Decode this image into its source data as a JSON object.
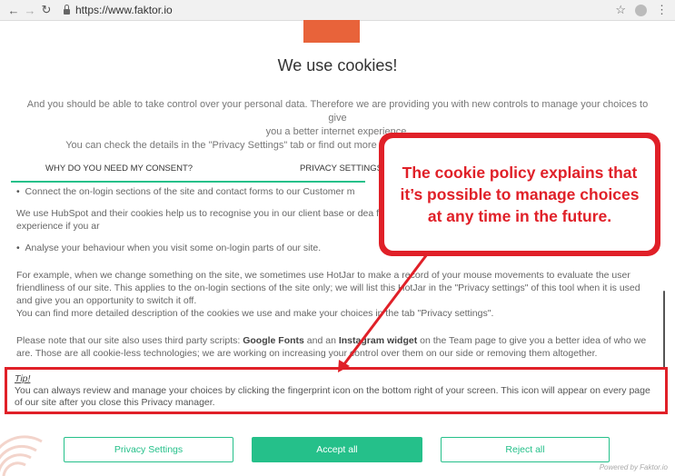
{
  "browser": {
    "url": "https://www.faktor.io",
    "icons": [
      "back-icon",
      "forward-icon",
      "reload-icon",
      "lock-icon",
      "star-icon",
      "profile-icon",
      "menu-icon"
    ]
  },
  "page": {
    "title": "We use cookies!",
    "intro_line1": "And you should be able to take control over your personal data. Therefore we are providing you with new controls to manage your choices to give",
    "intro_line2": "you a better internet experience.",
    "intro_line3": "You can check the details in the \"Privacy Settings\" tab or find out more about the cookies we use in the \"Cookie notice\" tab.",
    "tabs": [
      "WHY DO YOU NEED MY CONSENT?",
      "PRIVACY SETTINGS"
    ],
    "bullet1": "Connect the on-login sections of the site and contact forms to our Customer m",
    "para1": "We use HubSpot and their cookies help us to recognise you in our client base or dea forms. We recommend you to accept these cookies for the best experience if you ar",
    "bullet2": "Analyse your behaviour when you visit some on-login parts of our site.",
    "para2": "For example, when we change something on the site, we sometimes use HotJar to make a record of your mouse movements to evaluate the user friendliness of our site. This applies to the on-login sections of the site only; we will list this HotJar in the \"Privacy settings\" of this tool when it is used and give you an opportunity to switch it off.",
    "para2b": "You can find more detailed description of the cookies we use and make your choices in the tab \"Privacy settings\".",
    "para3_a": "Please note that our site also uses third party scripts: ",
    "para3_b1": "Google Fonts",
    "para3_c": " and an ",
    "para3_b2": "Instagram widget",
    "para3_d": " on the Team page to give you a better idea of who we are. Those are all cookie-less technologies; we are working on increasing your control over them on our side or removing them altogether.",
    "tip_title": "Tip!",
    "tip_text": "You can always review and manage your choices by clicking the fingerprint icon on the bottom right of your screen. This icon will appear on every page of our site after you close this Privacy manager."
  },
  "annotation": {
    "callout_text": "The cookie policy explains that it’s possible to manage choices at any time in the future.",
    "color": "#e02028"
  },
  "actions": {
    "privacy_settings": "Privacy Settings",
    "accept_all": "Accept all",
    "reject_all": "Reject all",
    "powered_by": "Powered by Faktor.io"
  },
  "colors": {
    "brand_orange": "#e8633a",
    "accent_green": "#25c08a"
  }
}
